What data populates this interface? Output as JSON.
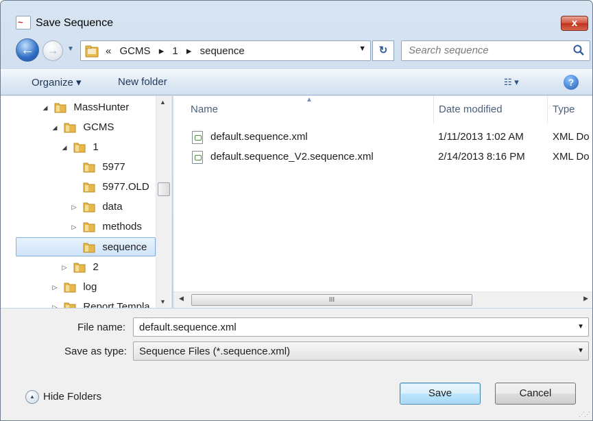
{
  "window": {
    "title": "Save Sequence",
    "close_label": "x"
  },
  "navigation": {
    "back_label": "←",
    "forward_label": "→",
    "breadcrumb": [
      "«",
      "GCMS",
      "▸",
      "1",
      "▸",
      "sequence"
    ],
    "refresh_label": "↻",
    "search_placeholder": "Search sequence"
  },
  "toolbar": {
    "organize_label": "Organize ▾",
    "new_folder_label": "New folder",
    "view_label": "☷ ▾",
    "help_label": "?"
  },
  "tree": {
    "items": [
      {
        "label": "MassHunter",
        "twisty": "◢",
        "level": 0
      },
      {
        "label": "GCMS",
        "twisty": "◢",
        "level": 1
      },
      {
        "label": "1",
        "twisty": "◢",
        "level": 2
      },
      {
        "label": "5977",
        "twisty": "",
        "level": 3
      },
      {
        "label": "5977.OLD",
        "twisty": "",
        "level": 3
      },
      {
        "label": "data",
        "twisty": "▷",
        "level": 3
      },
      {
        "label": "methods",
        "twisty": "▷",
        "level": 3
      },
      {
        "label": "sequence",
        "twisty": "",
        "level": 3,
        "selected": true
      },
      {
        "label": "2",
        "twisty": "▷",
        "level": 2
      },
      {
        "label": "log",
        "twisty": "▷",
        "level": 1
      },
      {
        "label": "Report Templa",
        "twisty": "▷",
        "level": 1
      }
    ]
  },
  "file_list": {
    "columns": [
      "Name",
      "Date modified",
      "Type"
    ],
    "rows": [
      {
        "name": "default.sequence.xml",
        "date": "1/11/2013 1:02 AM",
        "type": "XML Do"
      },
      {
        "name": "default.sequence_V2.sequence.xml",
        "date": "2/14/2013 8:16 PM",
        "type": "XML Do"
      }
    ],
    "scroll_label": "III"
  },
  "form": {
    "file_name_label": "File name:",
    "file_name_value": "default.sequence.xml",
    "save_as_type_label": "Save as type:",
    "save_as_type_value": "Sequence Files (*.sequence.xml)"
  },
  "footer": {
    "hide_folders_label": "Hide Folders",
    "save_label": "Save",
    "cancel_label": "Cancel"
  },
  "colors": {
    "selection": "#cfe3f9",
    "selection_border": "#84acdd",
    "folder": "#e8b94a"
  }
}
